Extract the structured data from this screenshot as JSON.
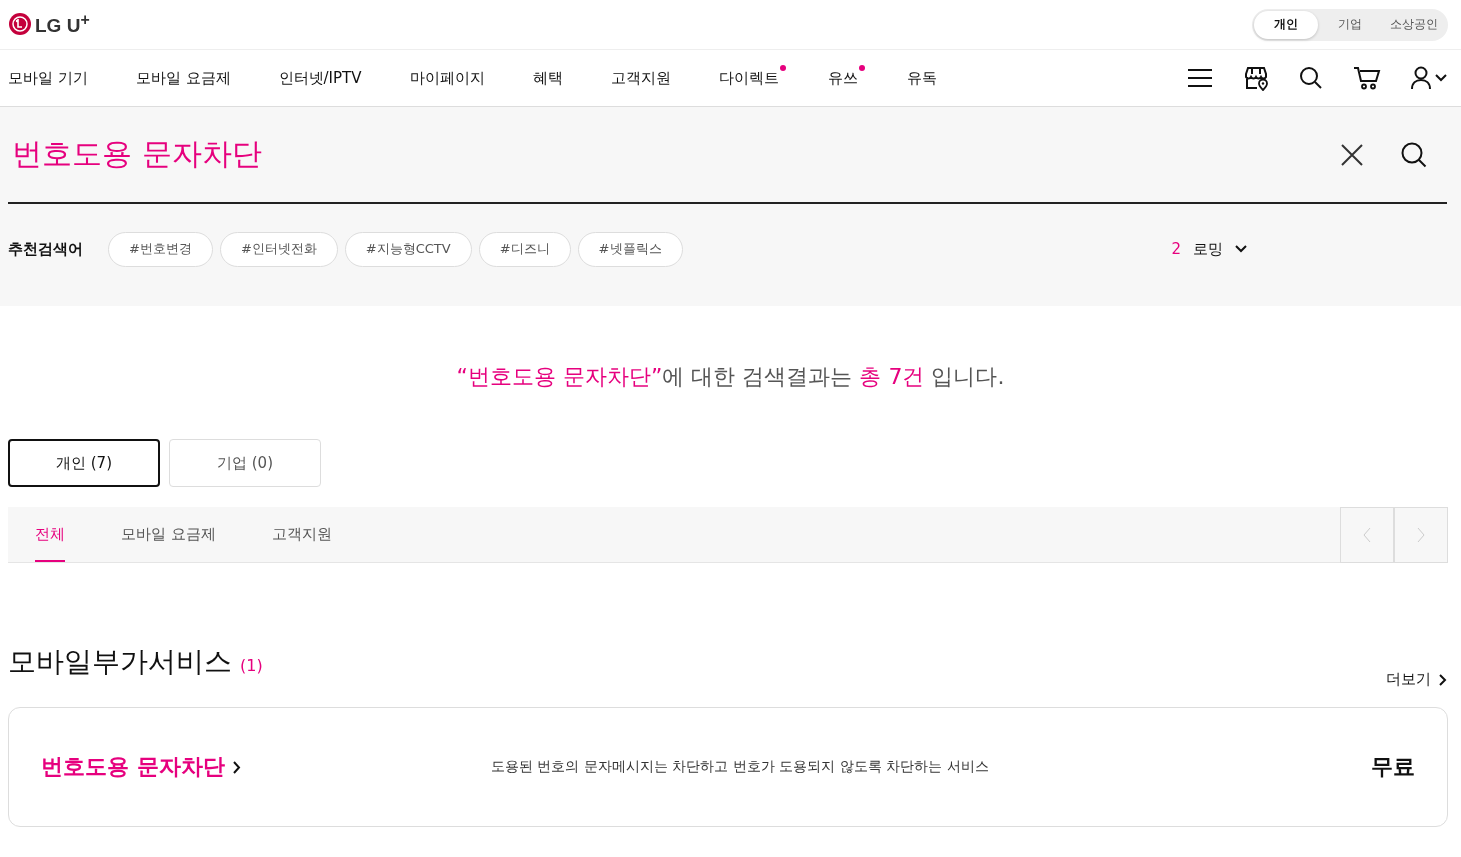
{
  "logo": "LG U$^{+}$",
  "segments": [
    {
      "label": "개인",
      "selected": true
    },
    {
      "label": "기업",
      "selected": false
    },
    {
      "label": "소상공인",
      "selected": false
    }
  ],
  "nav": [
    {
      "label": "모바일 기기",
      "dot": false
    },
    {
      "label": "모바일 요금제",
      "dot": false
    },
    {
      "label": "인터넷/IPTV",
      "dot": false
    },
    {
      "label": "마이페이지",
      "dot": false
    },
    {
      "label": "혜택",
      "dot": false
    },
    {
      "label": "고객지원",
      "dot": false
    },
    {
      "label": "다이렉트",
      "dot": true
    },
    {
      "label": "유쓰",
      "dot": true
    },
    {
      "label": "유독",
      "dot": false
    }
  ],
  "search": {
    "value": "번호도용 문자차단"
  },
  "recommended": {
    "label": "추천검색어",
    "tags": [
      "#번호변경",
      "#인터넷전화",
      "#지능형CCTV",
      "#디즈니",
      "#넷플릭스"
    ]
  },
  "ranking": {
    "rank": "2",
    "keyword": "로밍"
  },
  "result_sentence": [
    {
      "text": "“번호도용 문자차단”",
      "highlight": true
    },
    {
      "text": "에 대한 검색결과는 ",
      "highlight": false
    },
    {
      "text": "총 7건",
      "highlight": true
    },
    {
      "text": " 입니다.",
      "highlight": false
    }
  ],
  "audience_tabs": [
    {
      "label": "개인 (7)",
      "selected": true
    },
    {
      "label": "기업 (0)",
      "selected": false
    }
  ],
  "category_tabs": [
    {
      "label": "전체",
      "selected": true
    },
    {
      "label": "모바일 요금제",
      "selected": false
    },
    {
      "label": "고객지원",
      "selected": false
    }
  ],
  "section": {
    "title": "모바일부가서비스",
    "count": "(1)",
    "more": "더보기"
  },
  "results": [
    {
      "name": "번호도용 문자차단",
      "description": "도용된 번호의 문자메시지는 차단하고 번호가 도용되지 않도록 차단하는 서비스",
      "price": "무료"
    }
  ]
}
